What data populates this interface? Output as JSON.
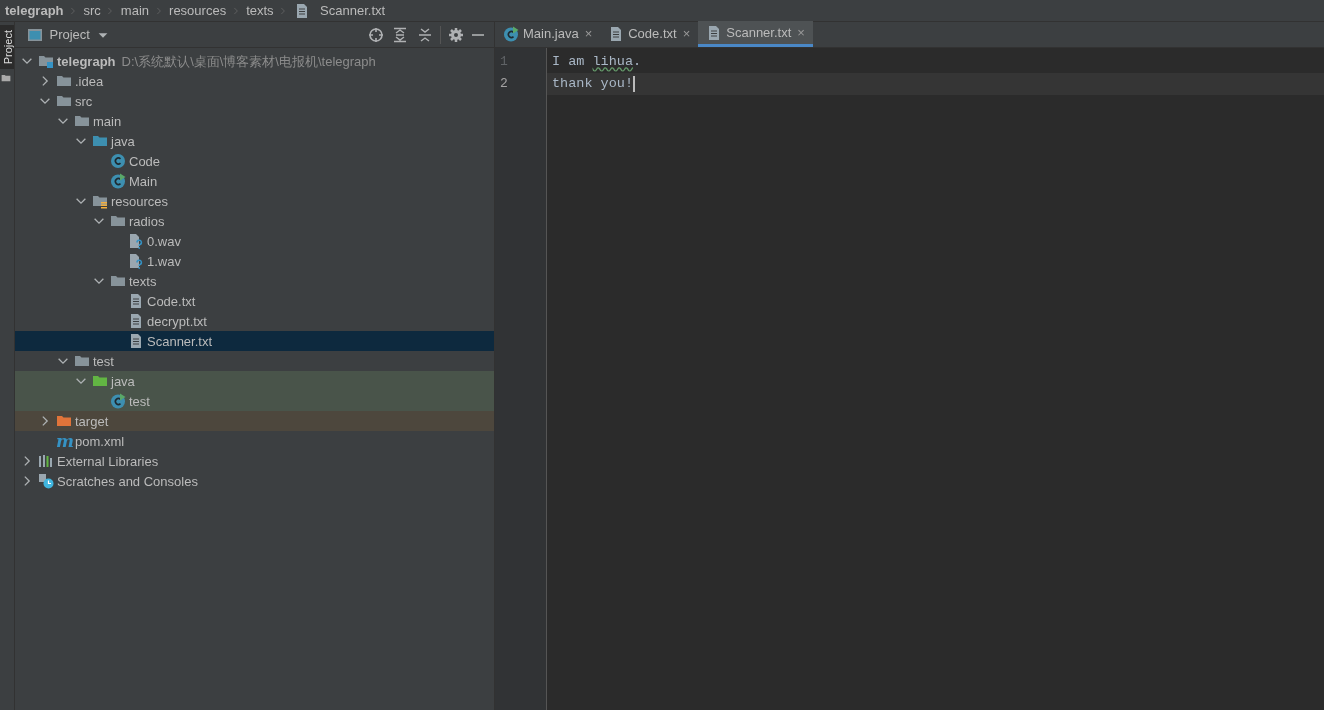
{
  "breadcrumb": [
    {
      "label": "telegraph",
      "kind": "root"
    },
    {
      "label": "src",
      "kind": "plain"
    },
    {
      "label": "main",
      "kind": "plain"
    },
    {
      "label": "resources",
      "kind": "plain"
    },
    {
      "label": "texts",
      "kind": "plain"
    },
    {
      "label": "Scanner.txt",
      "kind": "file"
    }
  ],
  "side_strip": {
    "tab": "Project",
    "selected": true
  },
  "project_panel": {
    "title": "Project",
    "tree": [
      {
        "label": "telegraph",
        "path": "D:\\系统默认\\桌面\\博客素材\\电报机\\telegraph",
        "kind": "module",
        "expanded": true,
        "selected": false,
        "children": [
          {
            "label": ".idea",
            "kind": "folder",
            "expanded": false,
            "selected": false
          },
          {
            "label": "src",
            "kind": "folder",
            "expanded": true,
            "selected": false,
            "children": [
              {
                "label": "main",
                "kind": "folder",
                "expanded": true,
                "selected": false,
                "children": [
                  {
                    "label": "java",
                    "kind": "source-folder",
                    "expanded": true,
                    "selected": false,
                    "children": [
                      {
                        "label": "Code",
                        "kind": "class",
                        "selected": false
                      },
                      {
                        "label": "Main",
                        "kind": "run-class",
                        "selected": false
                      }
                    ]
                  },
                  {
                    "label": "resources",
                    "kind": "resource-folder",
                    "expanded": true,
                    "selected": false,
                    "children": [
                      {
                        "label": "radios",
                        "kind": "folder",
                        "expanded": true,
                        "selected": false,
                        "children": [
                          {
                            "label": "0.wav",
                            "kind": "unknown-file",
                            "selected": false
                          },
                          {
                            "label": "1.wav",
                            "kind": "unknown-file",
                            "selected": false
                          }
                        ]
                      },
                      {
                        "label": "texts",
                        "kind": "folder",
                        "expanded": true,
                        "selected": false,
                        "children": [
                          {
                            "label": "Code.txt",
                            "kind": "text-file",
                            "selected": false
                          },
                          {
                            "label": "decrypt.txt",
                            "kind": "text-file",
                            "selected": false
                          },
                          {
                            "label": "Scanner.txt",
                            "kind": "text-file",
                            "selected": true
                          }
                        ]
                      }
                    ]
                  }
                ]
              },
              {
                "label": "test",
                "kind": "folder",
                "expanded": true,
                "selected": false,
                "children": [
                  {
                    "label": "java",
                    "kind": "test-folder",
                    "test_scope": true,
                    "expanded": true,
                    "selected": false,
                    "children": [
                      {
                        "label": "test",
                        "kind": "run-class",
                        "test_scope": true,
                        "selected": false
                      }
                    ]
                  }
                ]
              }
            ]
          },
          {
            "label": "target",
            "kind": "excluded-folder",
            "excluded": true,
            "expanded": false,
            "selected": false
          },
          {
            "label": "pom.xml",
            "kind": "maven",
            "icon_text": "m",
            "selected": false
          }
        ]
      },
      {
        "label": "External Libraries",
        "kind": "libraries",
        "expanded": false,
        "selected": false
      },
      {
        "label": "Scratches and Consoles",
        "kind": "scratches",
        "expanded": false,
        "selected": false
      }
    ]
  },
  "editor": {
    "tabs": [
      {
        "label": "Main.java",
        "kind": "run-class",
        "close": "×",
        "selected": false
      },
      {
        "label": "Code.txt",
        "kind": "text-file",
        "close": "×",
        "selected": false
      },
      {
        "label": "Scanner.txt",
        "kind": "text-file",
        "close": "×",
        "selected": true
      }
    ],
    "lines": [
      {
        "number": "1",
        "caret": false,
        "segments": [
          {
            "text": "I am "
          },
          {
            "text": "lihua",
            "typo": true
          },
          {
            "text": "."
          }
        ]
      },
      {
        "number": "2",
        "caret": true,
        "segments": [
          {
            "text": "thank you!"
          }
        ]
      }
    ]
  }
}
